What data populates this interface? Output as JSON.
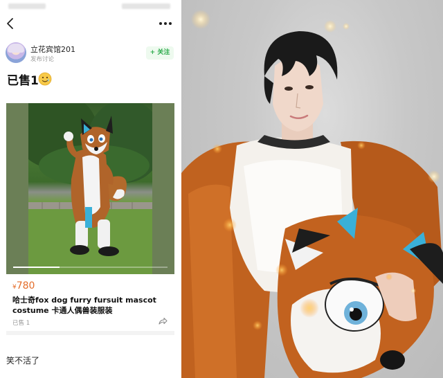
{
  "post": {
    "author": "立花宾馆201",
    "subtitle": "发布讨论",
    "follow_label": "+ 关注",
    "title": "已售1"
  },
  "listing": {
    "currency": "¥",
    "price": "780",
    "title": "哈士奇fox dog furry fursuit mascot costume 卡通人偶兽装服装",
    "sold": "已售 1",
    "image_progress": 0.3
  },
  "comment": {
    "text": "笑不活了"
  },
  "colors": {
    "accent_green": "#2aaa4a",
    "price_orange": "#e46d2a"
  }
}
